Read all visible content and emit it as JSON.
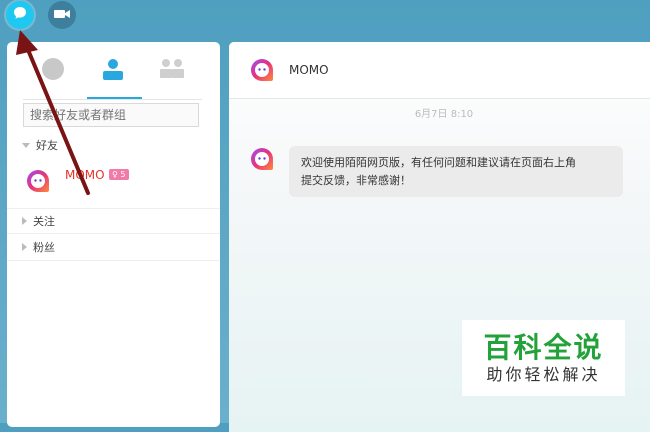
{
  "topbar": {
    "chat_icon": "chat-bubble-icon",
    "video_icon": "video-camera-icon"
  },
  "sidebar": {
    "tabs": [
      {
        "icon": "recent-chats-icon",
        "active": false
      },
      {
        "icon": "contacts-icon",
        "active": true
      },
      {
        "icon": "groups-icon",
        "active": false
      }
    ],
    "search_placeholder": "搜索好友或者群组",
    "friends_section": "好友",
    "friend": {
      "name": "MOMO",
      "badge": "♀ 5"
    },
    "follow_section": "关注",
    "fans_section": "粉丝"
  },
  "chat": {
    "title": "MOMO",
    "time": "6月7日 8:10",
    "message": "欢迎使用陌陌网页版，有任何问题和建议请在页面右上角\n提交反馈，非常感谢！"
  },
  "watermark": {
    "main": "百科全说",
    "sub": "助你轻松解决"
  },
  "colors": {
    "accent": "#29a8e0",
    "friend_name": "#e5332a",
    "badge": "#f17aa6",
    "watermark_green": "#23a23a"
  }
}
